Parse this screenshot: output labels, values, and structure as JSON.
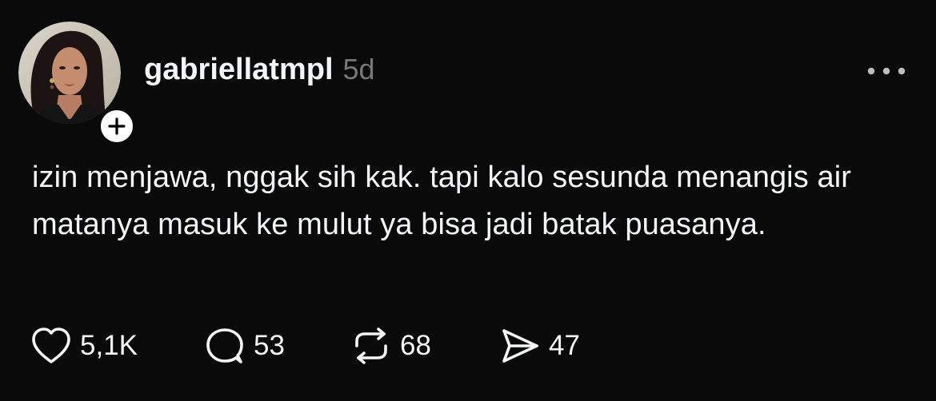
{
  "post": {
    "username": "gabriellatmpl",
    "timestamp": "5d",
    "text": "izin menjawa, nggak sih kak. tapi kalo sesunda menangis air matanya masuk ke mulut ya bisa jadi batak puasanya.",
    "actions": {
      "like_count": "5,1K",
      "reply_count": "53",
      "repost_count": "68",
      "share_count": "47"
    }
  },
  "icons": {
    "more": "more-horizontal-icon",
    "follow": "plus-icon",
    "like": "heart-icon",
    "reply": "comment-bubble-icon",
    "repost": "repost-icon",
    "share": "send-icon"
  },
  "colors": {
    "background": "#0a0a0a",
    "text": "#f3f5f7",
    "muted": "#777777"
  }
}
